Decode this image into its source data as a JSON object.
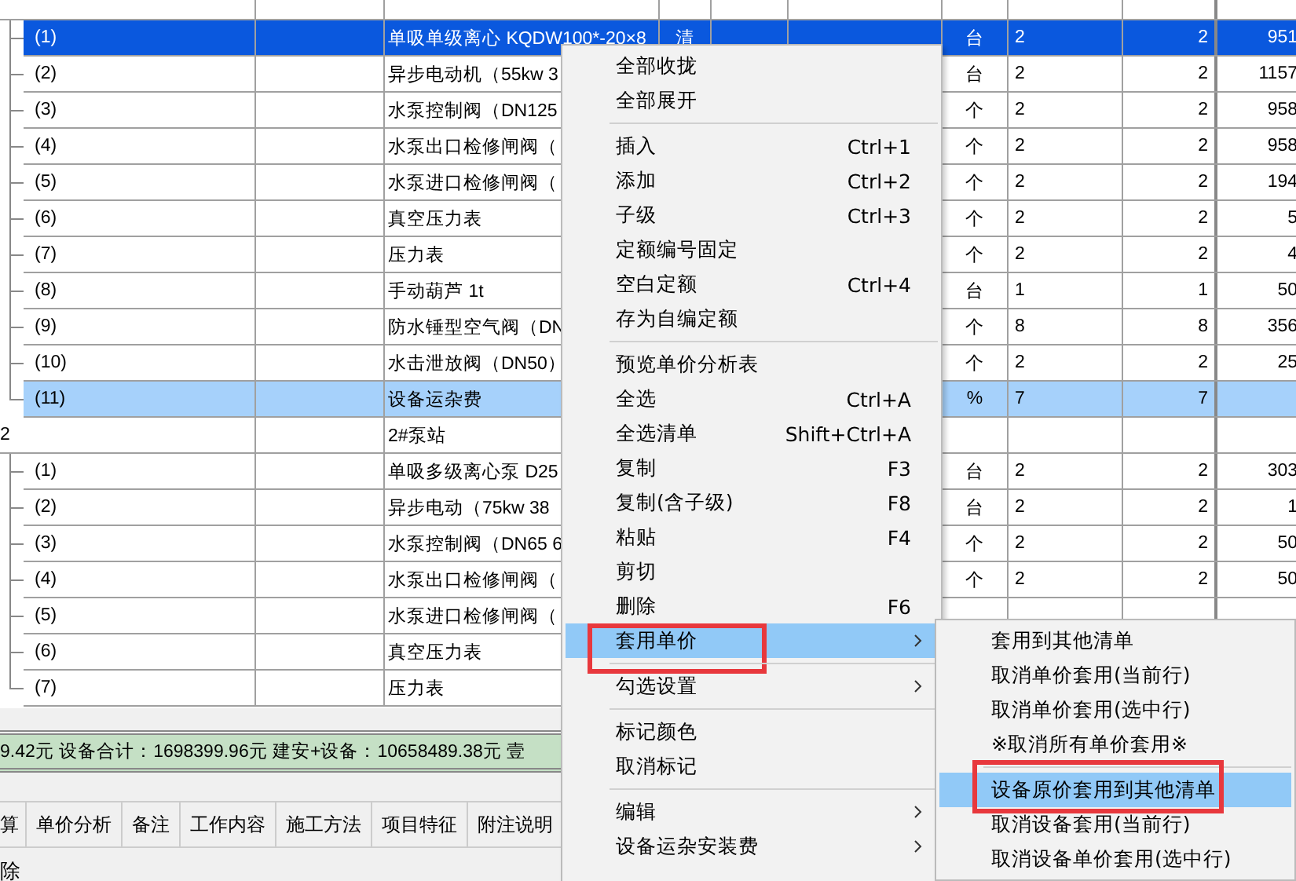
{
  "table": {
    "groups": [
      {
        "items": [
          {
            "code": "(1)",
            "name": "单吸单级离心 KQDW100*-20×8",
            "column_4": "清",
            "unit": "台",
            "quantity": "2",
            "quantity_2": "2",
            "price": "951",
            "selected": true,
            "highlighted": false
          },
          {
            "code": "(2)",
            "name": "异步电动机（55kw 3",
            "unit": "台",
            "quantity": "2",
            "quantity_2": "2",
            "price": "1157",
            "selected": false,
            "highlighted": false
          },
          {
            "code": "(3)",
            "name": "水泵控制阀（DN125",
            "unit": "个",
            "quantity": "2",
            "quantity_2": "2",
            "price": "958",
            "selected": false,
            "highlighted": false
          },
          {
            "code": "(4)",
            "name": "水泵出口检修闸阀（",
            "unit": "个",
            "quantity": "2",
            "quantity_2": "2",
            "price": "958",
            "selected": false,
            "highlighted": false
          },
          {
            "code": "(5)",
            "name": "水泵进口检修闸阀（",
            "unit": "个",
            "quantity": "2",
            "quantity_2": "2",
            "price": "194",
            "selected": false,
            "highlighted": false
          },
          {
            "code": "(6)",
            "name": "真空压力表",
            "unit": "个",
            "quantity": "2",
            "quantity_2": "2",
            "price": "5",
            "selected": false,
            "highlighted": false
          },
          {
            "code": "(7)",
            "name": "压力表",
            "unit": "个",
            "quantity": "2",
            "quantity_2": "2",
            "price": "4",
            "selected": false,
            "highlighted": false
          },
          {
            "code": "(8)",
            "name": "手动葫芦 1t",
            "unit": "台",
            "quantity": "1",
            "quantity_2": "1",
            "price": "50",
            "selected": false,
            "highlighted": false
          },
          {
            "code": "(9)",
            "name": "防水锤型空气阀（DN",
            "unit": "个",
            "quantity": "8",
            "quantity_2": "8",
            "price": "356",
            "selected": false,
            "highlighted": false
          },
          {
            "code": "(10)",
            "name": "水击泄放阀（DN50）",
            "unit": "个",
            "quantity": "2",
            "quantity_2": "2",
            "price": "25",
            "selected": false,
            "highlighted": false
          },
          {
            "code": "(11)",
            "name": "设备运杂费",
            "unit": "%",
            "quantity": "7",
            "quantity_2": "7",
            "selected": false,
            "highlighted": true
          }
        ]
      },
      {
        "code": "2",
        "name": "2#泵站",
        "items": [
          {
            "code": "(1)",
            "name": "单吸多级离心泵 D25",
            "unit": "台",
            "quantity": "2",
            "quantity_2": "2",
            "price": "303",
            "selected": false,
            "highlighted": false
          },
          {
            "code": "(2)",
            "name": "异步电动（75kw  38",
            "unit": "台",
            "quantity": "2",
            "quantity_2": "2",
            "price": "1",
            "selected": false,
            "highlighted": false
          },
          {
            "code": "(3)",
            "name": "水泵控制阀（DN65 6",
            "unit": "个",
            "quantity": "2",
            "quantity_2": "2",
            "price": "50",
            "selected": false,
            "highlighted": false
          },
          {
            "code": "(4)",
            "name": "水泵出口检修闸阀（",
            "unit": "个",
            "quantity": "2",
            "quantity_2": "2",
            "price": "50",
            "selected": false,
            "highlighted": false
          },
          {
            "code": "(5)",
            "name": "水泵进口检修闸阀（",
            "selected": false,
            "highlighted": false
          },
          {
            "code": "(6)",
            "name": "真空压力表",
            "selected": false,
            "highlighted": false
          },
          {
            "code": "(7)",
            "name": "压力表",
            "selected": false,
            "highlighted": false
          }
        ]
      }
    ]
  },
  "status_bar": "9.42元 设备合计：1698399.96元 建安+设备：10658489.38元  壹",
  "tabs": [
    {
      "label": "算",
      "selected": false
    },
    {
      "label": "单价分析",
      "selected": false
    },
    {
      "label": "备注",
      "selected": false
    },
    {
      "label": "工作内容",
      "selected": false
    },
    {
      "label": "施工方法",
      "selected": false
    },
    {
      "label": "项目特征",
      "selected": false
    },
    {
      "label": "附注说明",
      "selected": false
    }
  ],
  "bottom_text": "除",
  "menu": {
    "items": [
      {
        "kind": "item",
        "label": "全部收拢",
        "selected": false
      },
      {
        "kind": "item",
        "label": "全部展开",
        "selected": false
      },
      {
        "kind": "separator"
      },
      {
        "kind": "item",
        "label": "插入",
        "shortcut": "Ctrl+1",
        "selected": false
      },
      {
        "kind": "item",
        "label": "添加",
        "shortcut": "Ctrl+2",
        "selected": false
      },
      {
        "kind": "item",
        "label": "子级",
        "shortcut": "Ctrl+3",
        "selected": false
      },
      {
        "kind": "item",
        "label": "定额编号固定",
        "selected": false
      },
      {
        "kind": "item",
        "label": "空白定额",
        "shortcut": "Ctrl+4",
        "selected": false
      },
      {
        "kind": "item",
        "label": "存为自编定额",
        "selected": false
      },
      {
        "kind": "separator"
      },
      {
        "kind": "item",
        "label": "预览单价分析表",
        "selected": false
      },
      {
        "kind": "item",
        "label": "全选",
        "shortcut": "Ctrl+A",
        "selected": false
      },
      {
        "kind": "item",
        "label": "全选清单",
        "shortcut": "Shift+Ctrl+A",
        "selected": false
      },
      {
        "kind": "item",
        "label": "复制",
        "shortcut": "F3",
        "selected": false
      },
      {
        "kind": "item",
        "label": "复制(含子级)",
        "shortcut": "F8",
        "selected": false
      },
      {
        "kind": "item",
        "label": "粘贴",
        "shortcut": "F4",
        "selected": false
      },
      {
        "kind": "item",
        "label": "剪切",
        "selected": false
      },
      {
        "kind": "item",
        "label": "删除",
        "shortcut": "F6",
        "selected": false
      },
      {
        "kind": "item",
        "label": "套用单价",
        "submenu": true,
        "selected": true,
        "marked": true
      },
      {
        "kind": "separator"
      },
      {
        "kind": "item",
        "label": "勾选设置",
        "submenu": true,
        "selected": false
      },
      {
        "kind": "separator"
      },
      {
        "kind": "item",
        "label": "标记颜色",
        "selected": false
      },
      {
        "kind": "item",
        "label": "取消标记",
        "selected": false
      },
      {
        "kind": "separator"
      },
      {
        "kind": "item",
        "label": "编辑",
        "submenu": true,
        "selected": false
      },
      {
        "kind": "item",
        "label": "设备运杂安装费",
        "submenu": true,
        "selected": false
      }
    ]
  },
  "submenu": {
    "items": [
      {
        "kind": "item",
        "label": "套用到其他清单",
        "selected": false
      },
      {
        "kind": "item",
        "label": "取消单价套用(当前行)",
        "selected": false
      },
      {
        "kind": "item",
        "label": "取消单价套用(选中行)",
        "selected": false
      },
      {
        "kind": "item",
        "label": "※取消所有单价套用※",
        "selected": false
      },
      {
        "kind": "separator"
      },
      {
        "kind": "item",
        "label": "设备原价套用到其他清单",
        "selected": true,
        "marked": true
      },
      {
        "kind": "item",
        "label": "取消设备套用(当前行)",
        "selected": false
      },
      {
        "kind": "item",
        "label": "取消设备单价套用(选中行)",
        "selected": false
      }
    ]
  }
}
